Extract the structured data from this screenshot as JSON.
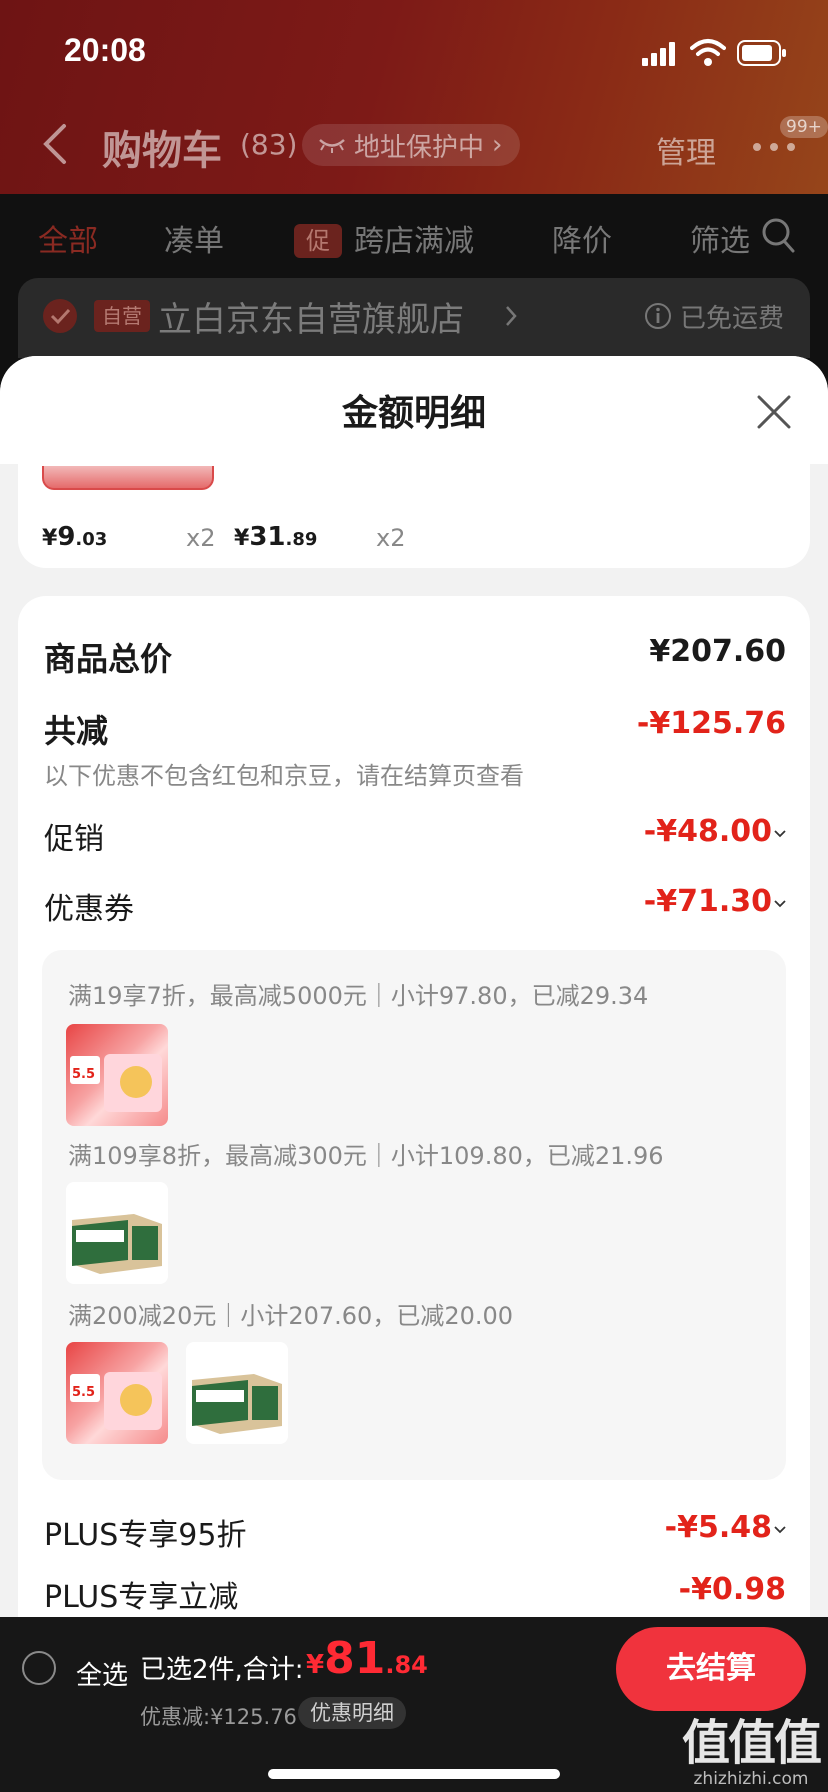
{
  "status_bar": {
    "time": "20:08"
  },
  "nav": {
    "title": "购物车",
    "count": "(83)",
    "address_protect": "地址保护中",
    "manage": "管理",
    "badge": "99+"
  },
  "tabs": {
    "all": "全部",
    "combine": "凑单",
    "promo_badge": "促",
    "cross_store": "跨店满减",
    "price_drop": "降价",
    "filter": "筛选"
  },
  "store": {
    "tag": "自营",
    "name": "立白京东自营旗舰店",
    "shipping": "已免运费"
  },
  "sheet": {
    "title": "金额明细",
    "products": [
      {
        "currency": "¥",
        "price_int": "9",
        "price_dec": ".03",
        "qty": "x2"
      },
      {
        "currency": "¥",
        "price_int": "31",
        "price_dec": ".89",
        "qty": "x2"
      }
    ],
    "goods_total": {
      "label": "商品总价",
      "value": "¥207.60"
    },
    "total_reduce": {
      "label": "共减",
      "value": "-¥125.76",
      "note": "以下优惠不包含红包和京豆，请在结算页查看"
    },
    "promotion": {
      "label": "促销",
      "value": "-¥48.00"
    },
    "coupon": {
      "label": "优惠券",
      "value": "-¥71.30"
    },
    "coupon_details": [
      "满19享7折，最高减5000元｜小计97.80，已减29.34",
      "满109享8折，最高减300元｜小计109.80，已减21.96",
      "满200减20元｜小计207.60，已减20.00"
    ],
    "plus95": {
      "label": "PLUS专享95折",
      "value": "-¥5.48"
    },
    "plus_reduce": {
      "label": "PLUS专享立减",
      "value": "-¥0.98"
    }
  },
  "bottom": {
    "select_all": "全选",
    "selected": "已选2件,合计:",
    "currency": "¥",
    "total_int": "81",
    "total_dec": ".84",
    "discount": "优惠减:¥125.76",
    "detail_button": "优惠明细",
    "checkout": "去结算"
  },
  "watermark": {
    "chars": "值值值",
    "url": "zhizhizhi.com"
  },
  "colors": {
    "accent_red": "#e2231a",
    "checkout": "#f0333d",
    "sheet_bg": "#f2f2f2"
  }
}
